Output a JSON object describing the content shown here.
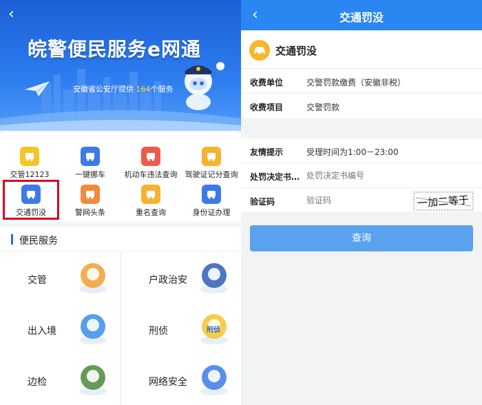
{
  "left": {
    "banner": {
      "title": "皖警便民服务e网通",
      "subtitle_prefix": "安徽省公安厅提供",
      "service_count": "164",
      "subtitle_suffix": "个服务"
    },
    "services": [
      {
        "label": "交管12123",
        "icon": "traffic-12123-icon",
        "color": "#f5c528"
      },
      {
        "label": "一键挪车",
        "icon": "move-car-icon",
        "color": "#3d7ae8"
      },
      {
        "label": "机动车违法查询",
        "icon": "violation-query-icon",
        "color": "#ef5a4a"
      },
      {
        "label": "驾驶证记分查询",
        "icon": "license-points-icon",
        "color": "#f5b330"
      },
      {
        "label": "交通罚没",
        "icon": "traffic-fine-icon",
        "color": "#3d7ae8"
      },
      {
        "label": "警网头条",
        "icon": "police-news-icon",
        "color": "#f08a3c"
      },
      {
        "label": "重名查询",
        "icon": "name-query-icon",
        "color": "#f5b330"
      },
      {
        "label": "身份证办理",
        "icon": "id-card-icon",
        "color": "#3d7ae8"
      }
    ],
    "section_title": "便民服务",
    "categories": [
      {
        "label": "交管",
        "icon": "traffic-cars-icon"
      },
      {
        "label": "户政治安",
        "icon": "police-officer-icon"
      },
      {
        "label": "出入境",
        "icon": "airplane-icon"
      },
      {
        "label": "刑侦",
        "icon": "criminal-investigation-icon",
        "badge": "刑侦"
      },
      {
        "label": "边检",
        "icon": "border-guard-icon"
      },
      {
        "label": "网络安全",
        "icon": "cyber-security-icon"
      }
    ]
  },
  "right": {
    "nav_title": "交通罚没",
    "header_title": "交通罚没",
    "rows": [
      {
        "key": "收费单位",
        "value": "交警罚款缴费（安徽非税）"
      },
      {
        "key": "收费项目",
        "value": "交警罚款"
      }
    ],
    "form": [
      {
        "key": "友情提示",
        "value": "受理时间为1:00－23:00"
      },
      {
        "key": "处罚决定书…",
        "placeholder": "处罚决定书编号"
      },
      {
        "key": "验证码",
        "placeholder": "验证码"
      }
    ],
    "captcha_text": "一加二等于",
    "submit_label": "查询"
  }
}
